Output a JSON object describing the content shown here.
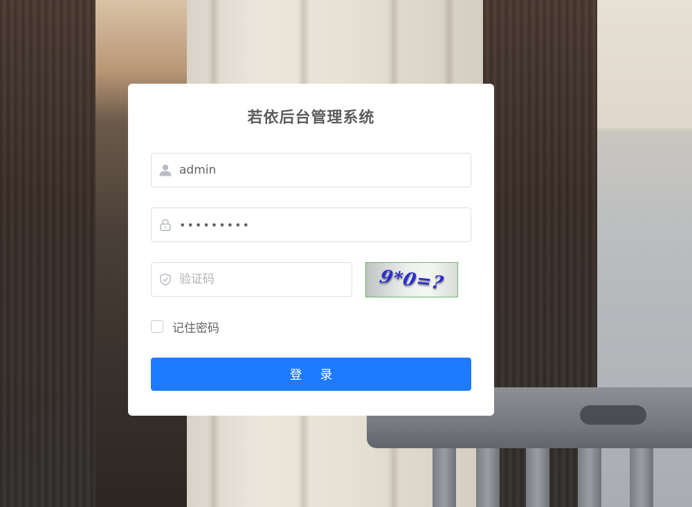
{
  "login": {
    "title": "若依后台管理系统",
    "username": {
      "value": "admin",
      "icon": "user-icon"
    },
    "password": {
      "value": "•••••••••",
      "icon": "lock-icon"
    },
    "code": {
      "placeholder": "验证码",
      "icon": "shield-check-icon",
      "value": ""
    },
    "captcha": {
      "text": "9*0=?"
    },
    "remember": {
      "label": "记住密码",
      "checked": false
    },
    "submit_label": "登 录"
  },
  "colors": {
    "primary": "#1e7bff",
    "title": "#5d5d5d",
    "text": "#606266",
    "border": "#dcdfe6",
    "captcha_text": "#2b2fc9"
  }
}
